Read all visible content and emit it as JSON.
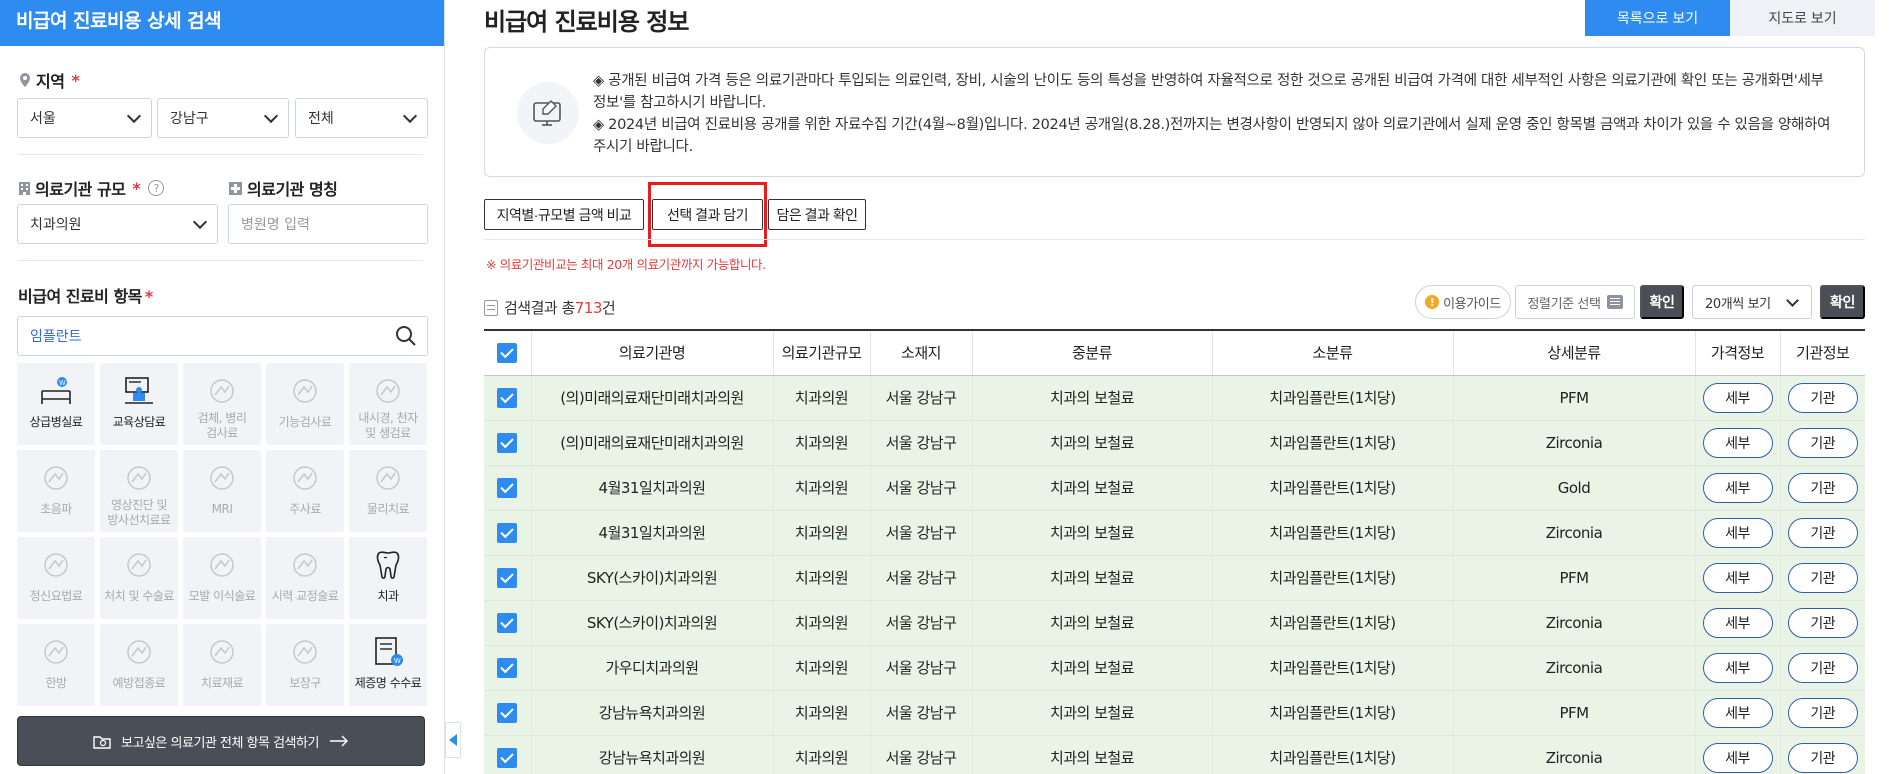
{
  "sidebar": {
    "title": "비급여 진료비용 상세 검색",
    "region": {
      "label": "지역",
      "required": "*",
      "province": "서울",
      "district": "강남구",
      "dong": "전체"
    },
    "scale": {
      "label": "의료기관 규모",
      "required": "*",
      "value": "치과의원"
    },
    "hospital_name": {
      "label": "의료기관 명칭",
      "placeholder": "병원명 입력"
    },
    "items": {
      "label": "비급여 진료비 항목",
      "required": "*",
      "search_value": "임플란트"
    },
    "categories": [
      {
        "label": "상급병실료",
        "icon": "hospital-bed-icon",
        "active": true
      },
      {
        "label": "교육상담료",
        "icon": "consultation-icon",
        "active": true
      },
      {
        "label": "검체, 병리\n검사료",
        "icon": "lab-test-icon",
        "active": false
      },
      {
        "label": "기능검사료",
        "icon": "function-test-icon",
        "active": false
      },
      {
        "label": "내시경, 천자\n및 생검료",
        "icon": "endoscope-icon",
        "active": false
      },
      {
        "label": "초음파",
        "icon": "ultrasound-icon",
        "active": false
      },
      {
        "label": "영상진단 및\n방사선치료료",
        "icon": "radiology-icon",
        "active": false
      },
      {
        "label": "MRI",
        "icon": "mri-icon",
        "active": false
      },
      {
        "label": "주사료",
        "icon": "syringe-icon",
        "active": false
      },
      {
        "label": "물리치료",
        "icon": "physical-therapy-icon",
        "active": false
      },
      {
        "label": "정신요법료",
        "icon": "psychotherapy-icon",
        "active": false
      },
      {
        "label": "처치 및 수술료",
        "icon": "surgery-icon",
        "active": false
      },
      {
        "label": "모발 이식술료",
        "icon": "hair-transplant-icon",
        "active": false
      },
      {
        "label": "시력 교정술료",
        "icon": "eye-icon",
        "active": false
      },
      {
        "label": "치과",
        "icon": "tooth-icon",
        "active": true
      },
      {
        "label": "한방",
        "icon": "acupuncture-icon",
        "active": false
      },
      {
        "label": "예방접종료",
        "icon": "vaccine-icon",
        "active": false
      },
      {
        "label": "치료재료",
        "icon": "material-icon",
        "active": false
      },
      {
        "label": "보장구",
        "icon": "wheelchair-icon",
        "active": false
      },
      {
        "label": "제증명 수수료",
        "icon": "certificate-icon",
        "active": true
      }
    ],
    "search_all_label": "보고싶은 의료기관 전체 항목 검색하기"
  },
  "header": {
    "title": "비급여 진료비용 정보",
    "list_view_label": "목록으로 보기",
    "map_view_label": "지도로 보기"
  },
  "notice": {
    "line1": "◈ 공개된 비급여 가격 등은 의료기관마다 투입되는 의료인력, 장비, 시술의 난이도 등의 특성을 반영하여 자율적으로 정한 것으로 공개된 비급여 가격에 대한 세부적인 사항은 의료기관에 확인 또는 공개화면'세부정보'를 참고하시기 바랍니다.",
    "line2": "◈ 2024년 비급여 진료비용 공개를 위한 자료수집 기간(4월~8월)입니다. 2024년 공개일(8.28.)전까지는 변경사항이 반영되지 않아 의료기관에서 실제 운영 중인 항목별 금액과 차이가 있을 수 있음을 양해하여 주시기 바랍니다."
  },
  "toolbar": {
    "compare_label": "지역별·규모별 금액 비교",
    "add_selected_label": "선택 결과 담기",
    "view_saved_label": "담은 결과 확인",
    "warning": "※ 의료기관비교는 최대 20개 의료기관까지 가능합니다."
  },
  "results": {
    "count_prefix": "검색결과 총",
    "count": "713",
    "count_suffix": "건",
    "guide_label": "이용가이드",
    "sort_label": "정렬기준 선택",
    "confirm_label": "확인",
    "page_size": "20개씩 보기"
  },
  "table": {
    "columns": [
      "의료기관명",
      "의료기관규모",
      "소재지",
      "중분류",
      "소분류",
      "상세분류",
      "가격정보",
      "기관정보"
    ],
    "detail_label": "세부",
    "institution_label": "기관",
    "rows": [
      {
        "name": "(의)미래의료재단미래치과의원",
        "scale": "치과의원",
        "location": "서울 강남구",
        "mid": "치과의 보철료",
        "sub": "치과임플란트(1치당)",
        "detail": "PFM"
      },
      {
        "name": "(의)미래의료재단미래치과의원",
        "scale": "치과의원",
        "location": "서울 강남구",
        "mid": "치과의 보철료",
        "sub": "치과임플란트(1치당)",
        "detail": "Zirconia"
      },
      {
        "name": "4월31일치과의원",
        "scale": "치과의원",
        "location": "서울 강남구",
        "mid": "치과의 보철료",
        "sub": "치과임플란트(1치당)",
        "detail": "Gold"
      },
      {
        "name": "4월31일치과의원",
        "scale": "치과의원",
        "location": "서울 강남구",
        "mid": "치과의 보철료",
        "sub": "치과임플란트(1치당)",
        "detail": "Zirconia"
      },
      {
        "name": "SKY(스카이)치과의원",
        "scale": "치과의원",
        "location": "서울 강남구",
        "mid": "치과의 보철료",
        "sub": "치과임플란트(1치당)",
        "detail": "PFM"
      },
      {
        "name": "SKY(스카이)치과의원",
        "scale": "치과의원",
        "location": "서울 강남구",
        "mid": "치과의 보철료",
        "sub": "치과임플란트(1치당)",
        "detail": "Zirconia"
      },
      {
        "name": "가우디치과의원",
        "scale": "치과의원",
        "location": "서울 강남구",
        "mid": "치과의 보철료",
        "sub": "치과임플란트(1치당)",
        "detail": "Zirconia"
      },
      {
        "name": "강남뉴욕치과의원",
        "scale": "치과의원",
        "location": "서울 강남구",
        "mid": "치과의 보철료",
        "sub": "치과임플란트(1치당)",
        "detail": "PFM"
      },
      {
        "name": "강남뉴욕치과의원",
        "scale": "치과의원",
        "location": "서울 강남구",
        "mid": "치과의 보철료",
        "sub": "치과임플란트(1치당)",
        "detail": "Zirconia"
      }
    ]
  },
  "colors": {
    "accent": "#2e8cf0",
    "required": "#e23b3b",
    "row_bg": "#e9f4e6",
    "dark_button": "#4a4f57",
    "highlight_box": "#e51d1d"
  }
}
